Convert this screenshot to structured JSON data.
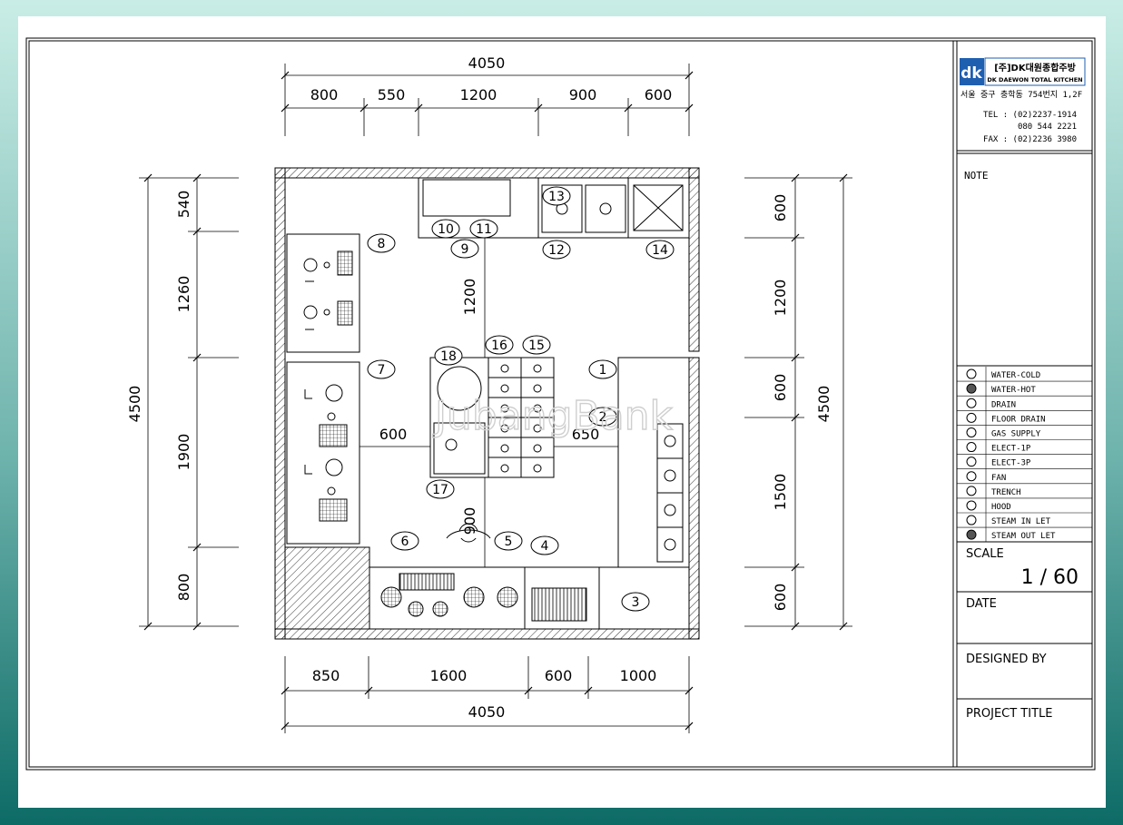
{
  "company": {
    "name_kr": "[주]DK대원종합주방",
    "name_en": "DK DAEWON TOTAL KITCHEN",
    "logo_letters": "dk",
    "address": "서울 중구 충학동 754번지 1,2F",
    "tel1": "TEL : (02)2237-1914",
    "tel2": "080 544 2221",
    "fax": "FAX : (02)2236 3980"
  },
  "note_label": "NOTE",
  "legend": [
    {
      "icon": "water-cold-icon",
      "label": "WATER-COLD"
    },
    {
      "icon": "water-hot-icon",
      "label": "WATER-HOT"
    },
    {
      "icon": "drain-icon",
      "label": "DRAIN"
    },
    {
      "icon": "floor-drain-icon",
      "label": "FLOOR DRAIN"
    },
    {
      "icon": "gas-supply-icon",
      "label": "GAS SUPPLY"
    },
    {
      "icon": "elect-1p-icon",
      "label": "ELECT-1P"
    },
    {
      "icon": "elect-3p-icon",
      "label": "ELECT-3P"
    },
    {
      "icon": "fan-icon",
      "label": "FAN"
    },
    {
      "icon": "trench-icon",
      "label": "TRENCH"
    },
    {
      "icon": "hood-icon",
      "label": "HOOD"
    },
    {
      "icon": "steam-inlet-icon",
      "label": "STEAM IN LET"
    },
    {
      "icon": "steam-outlet-icon",
      "label": "STEAM OUT LET"
    }
  ],
  "scale": {
    "label": "SCALE",
    "value": "1 / 60"
  },
  "date_label": "DATE",
  "designed_by_label": "DESIGNED BY",
  "project_title_label": "PROJECT TITLE",
  "watermark": "JubangBank",
  "dimensions": {
    "top_total": "4050",
    "top_segments": [
      "800",
      "550",
      "1200",
      "900",
      "600"
    ],
    "bottom_segments": [
      "850",
      "1600",
      "600",
      "1000"
    ],
    "bottom_total": "4050",
    "left_total": "4500",
    "left_segments": [
      "540",
      "1260",
      "1900",
      "800"
    ],
    "right_total": "4500",
    "right_segments": [
      "600",
      "1200",
      "600",
      "1500",
      "600"
    ],
    "inner_1200": "1200",
    "inner_600": "600",
    "inner_650": "650",
    "inner_900": "900"
  },
  "equipment_numbers": [
    "1",
    "2",
    "3",
    "4",
    "5",
    "6",
    "7",
    "8",
    "9",
    "10",
    "11",
    "12",
    "13",
    "14",
    "15",
    "16",
    "17",
    "18"
  ]
}
